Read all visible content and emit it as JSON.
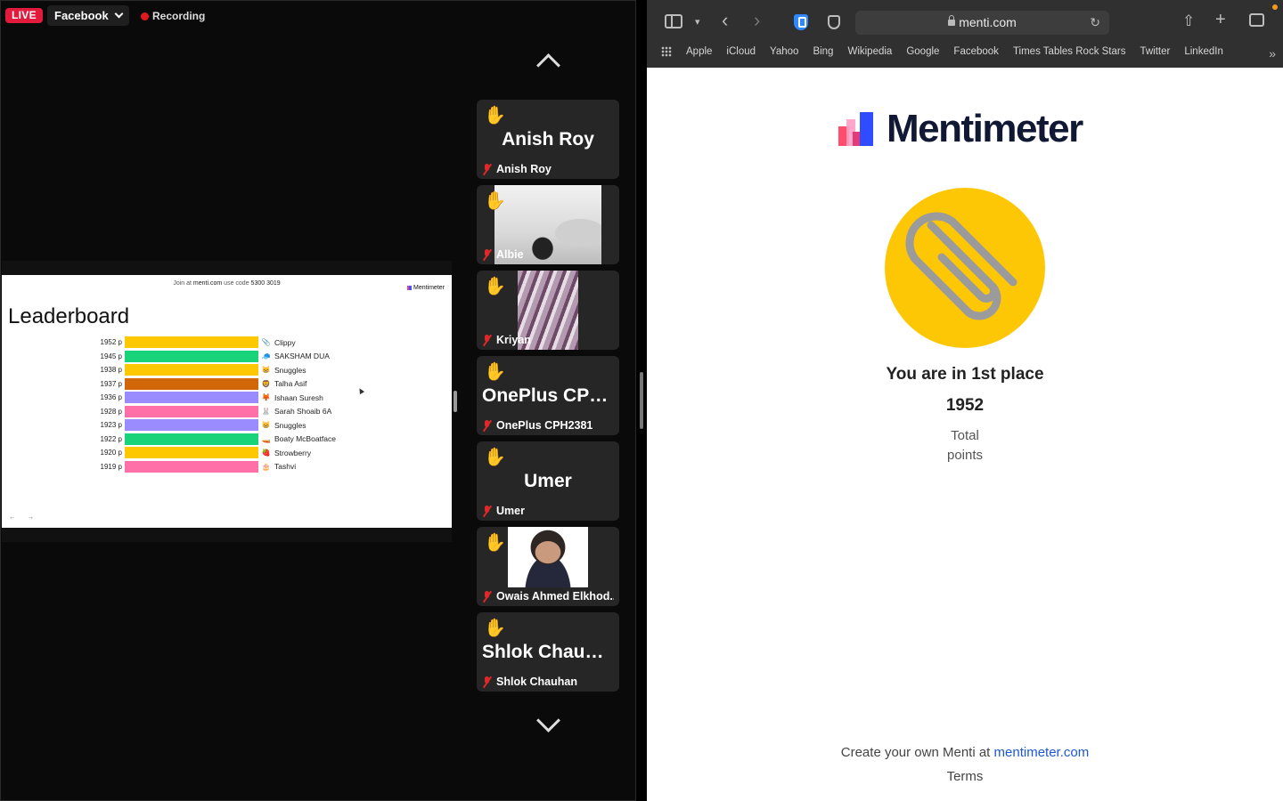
{
  "meeting": {
    "live_label": "LIVE",
    "stream_target": "Facebook",
    "recording_label": "Recording",
    "shared_slide": {
      "join_prefix": "Join at",
      "join_site": "menti.com",
      "code_prefix": "use code",
      "code": "5300 3019",
      "logo_text": "Mentimeter",
      "title": "Leaderboard",
      "rows": [
        {
          "points": "1952 p",
          "name": "Clippy",
          "color": "#fdc800",
          "icon": "📎"
        },
        {
          "points": "1945 p",
          "name": "SAKSHAM DUA",
          "color": "#19d37a",
          "icon": "🧢"
        },
        {
          "points": "1938 p",
          "name": "Snuggles",
          "color": "#fdc800",
          "icon": "😸"
        },
        {
          "points": "1937 p",
          "name": "Talha Asif",
          "color": "#d2670a",
          "icon": "🦁"
        },
        {
          "points": "1936 p",
          "name": "Ishaan Suresh",
          "color": "#9a8bff",
          "icon": "🦊"
        },
        {
          "points": "1928 p",
          "name": "Sarah Shoaib 6A",
          "color": "#ff6fa8",
          "icon": "🐰"
        },
        {
          "points": "1923 p",
          "name": "Snuggles",
          "color": "#9a8bff",
          "icon": "😸"
        },
        {
          "points": "1922 p",
          "name": "Boaty McBoatface",
          "color": "#19d37a",
          "icon": "🚤"
        },
        {
          "points": "1920 p",
          "name": "Strowberry",
          "color": "#fdc800",
          "icon": "🍓"
        },
        {
          "points": "1919 p",
          "name": "Tashvi",
          "color": "#ff6fa8",
          "icon": "🎂"
        }
      ],
      "nav": "← →"
    },
    "participants": [
      {
        "display_name": "Anish Roy",
        "name": "Anish Roy",
        "hand": "✋",
        "video": false
      },
      {
        "display_name": "",
        "name": "Albie",
        "hand": "✋",
        "video": true
      },
      {
        "display_name": "",
        "name": "Kriyan",
        "hand": "✋",
        "video": true
      },
      {
        "display_name": "OnePlus CPH...",
        "name": "OnePlus CPH2381",
        "hand": "✋",
        "video": false
      },
      {
        "display_name": "Umer",
        "name": "Umer",
        "hand": "✋",
        "video": false
      },
      {
        "display_name": "",
        "name": "Owais Ahmed Elkhod...",
        "hand": "✋",
        "video": true
      },
      {
        "display_name": "Shlok Chauhan",
        "name": "Shlok Chauhan",
        "hand": "✋",
        "video": false
      }
    ]
  },
  "browser": {
    "url": "menti.com",
    "bookmarks": [
      "Apple",
      "iCloud",
      "Yahoo",
      "Bing",
      "Wikipedia",
      "Google",
      "Facebook",
      "Times Tables Rock Stars",
      "Twitter",
      "LinkedIn"
    ],
    "icons": {
      "sidebar": "sidebar-icon",
      "tab_menu": "chevron-down-icon",
      "back": "back-icon",
      "forward": "forward-icon",
      "extension": "shield-icon",
      "privacy": "privacy-icon",
      "reload": "reload-icon",
      "share": "share-icon",
      "new_tab": "plus-icon",
      "tabs": "tabs-overview-icon"
    }
  },
  "menti": {
    "brand": "Mentimeter",
    "avatar": "paperclip",
    "place_text": "You are in 1st place",
    "score": "1952",
    "score_label_line1": "Total",
    "score_label_line2": "points",
    "cta_prefix": "Create your own Menti at",
    "cta_link": "mentimeter.com",
    "terms": "Terms",
    "colors": {
      "avatar_bg": "#fec706",
      "link": "#1d57d6",
      "brand_text": "#101834"
    }
  }
}
